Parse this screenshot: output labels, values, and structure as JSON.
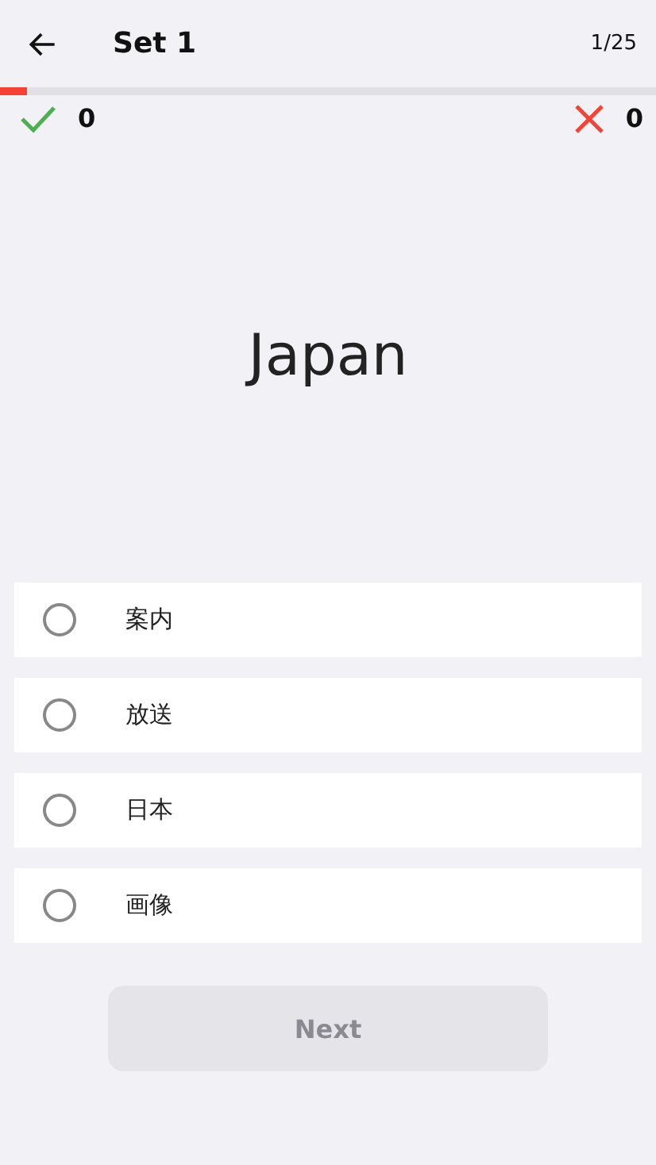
{
  "header": {
    "title": "Set 1",
    "counter": "1/25"
  },
  "progress": {
    "level": 0.04
  },
  "score": {
    "correct": "0",
    "wrong": "0"
  },
  "question": {
    "word": "Japan"
  },
  "options": [
    {
      "label": "案内",
      "selected": false
    },
    {
      "label": "放送",
      "selected": false
    },
    {
      "label": "日本",
      "selected": false
    },
    {
      "label": "画像",
      "selected": false
    }
  ],
  "next_button": {
    "label": "Next",
    "disabled": true
  }
}
